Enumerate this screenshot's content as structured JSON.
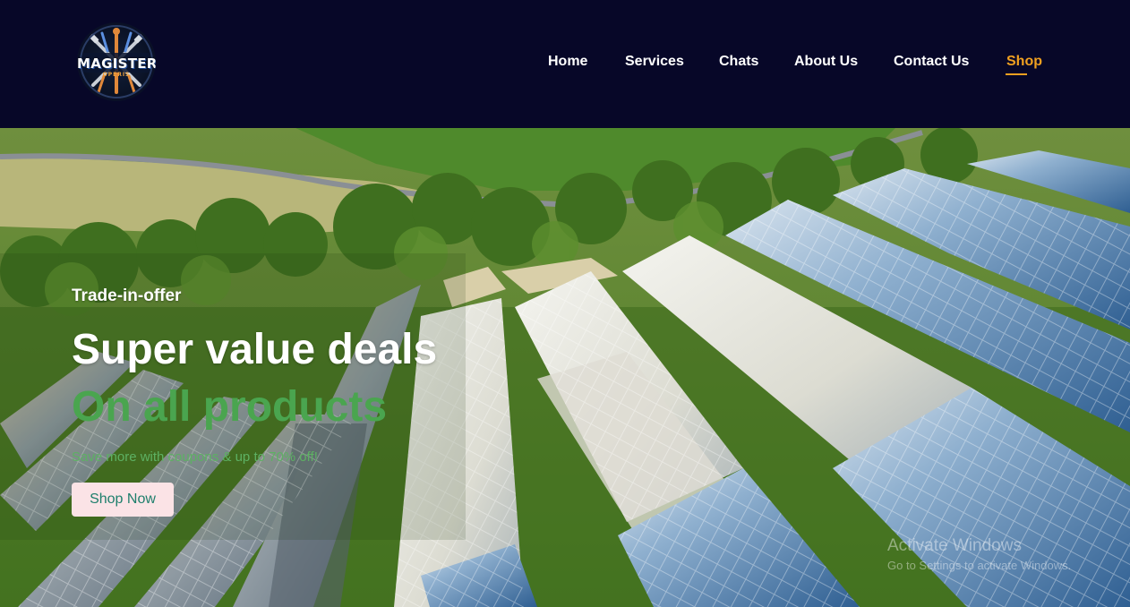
{
  "logo": {
    "icon": "tools-crest-icon",
    "title": "MAGISTER",
    "subtitle": "OPERIS"
  },
  "nav": {
    "items": [
      {
        "label": "Home",
        "active": false
      },
      {
        "label": "Services",
        "active": false
      },
      {
        "label": "Chats",
        "active": false
      },
      {
        "label": "About Us",
        "active": false
      },
      {
        "label": "Contact Us",
        "active": false
      },
      {
        "label": "Shop",
        "active": true
      }
    ]
  },
  "hero": {
    "kicker": "Trade-in-offer",
    "headline": "Super value deals",
    "subheadline": "On all products",
    "description": "Save more with coupons & up to 70% off!",
    "cta_label": "Shop Now"
  },
  "watermark": {
    "title": "Activate Windows",
    "subtitle": "Go to Settings to activate Windows."
  },
  "colors": {
    "header_bg": "#070728",
    "active_nav": "#f0a020",
    "accent_green": "#4aa54f",
    "button_bg": "#fbe3e6",
    "button_text": "#1e7f6c"
  }
}
